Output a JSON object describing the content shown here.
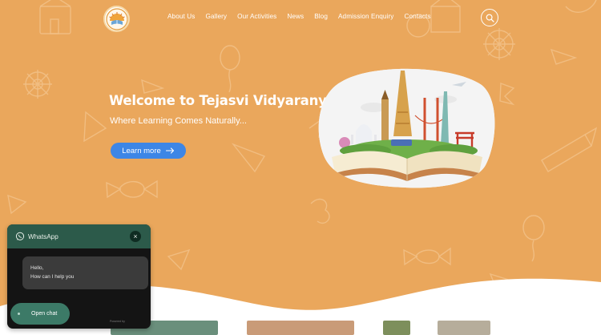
{
  "nav": {
    "items": [
      "About Us",
      "Gallery",
      "Our Activities",
      "News",
      "Blog",
      "Admission Enquiry",
      "Contacts"
    ]
  },
  "hero": {
    "title": "Welcome to Tejasvi Vidyaranya",
    "subtitle": "Where Learning Comes Naturally...",
    "button_label": "Learn more"
  },
  "whatsapp": {
    "title": "WhatsApp",
    "message_line1": "Hello,",
    "message_line2": "How can I help you",
    "open_label": "Open chat",
    "powered_by": "Powered by"
  },
  "colors": {
    "background": "#eaa75c",
    "button": "#3d86e6",
    "whatsapp_header": "#2c5a4a",
    "whatsapp_button": "#3c7a67"
  },
  "icons": [
    "search-icon",
    "arrow-right-icon",
    "whatsapp-icon",
    "close-icon"
  ]
}
